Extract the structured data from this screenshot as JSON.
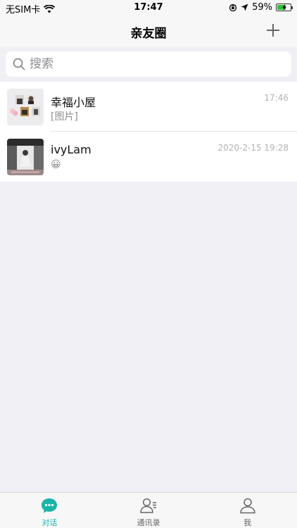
{
  "status_bar": {
    "carrier": "无SIM卡",
    "time": "17:47",
    "battery_percent": "59%",
    "battery_level": 0.59
  },
  "nav": {
    "title": "亲友圈",
    "add_icon": "plus-icon"
  },
  "search": {
    "placeholder": "搜索",
    "value": ""
  },
  "chats": [
    {
      "name": "幸福小屋",
      "preview": "[图片]",
      "time": "17:46"
    },
    {
      "name": "ivyLam",
      "preview": "😀",
      "time": "2020-2-15  19:28"
    }
  ],
  "tabs": [
    {
      "label": "对话",
      "icon": "chat-bubble-icon",
      "active": true
    },
    {
      "label": "通讯录",
      "icon": "contacts-icon",
      "active": false
    },
    {
      "label": "我",
      "icon": "profile-icon",
      "active": false
    }
  ],
  "colors": {
    "accent": "#1ab5a8",
    "background": "#efeff4",
    "battery": "#2ebf3a"
  }
}
